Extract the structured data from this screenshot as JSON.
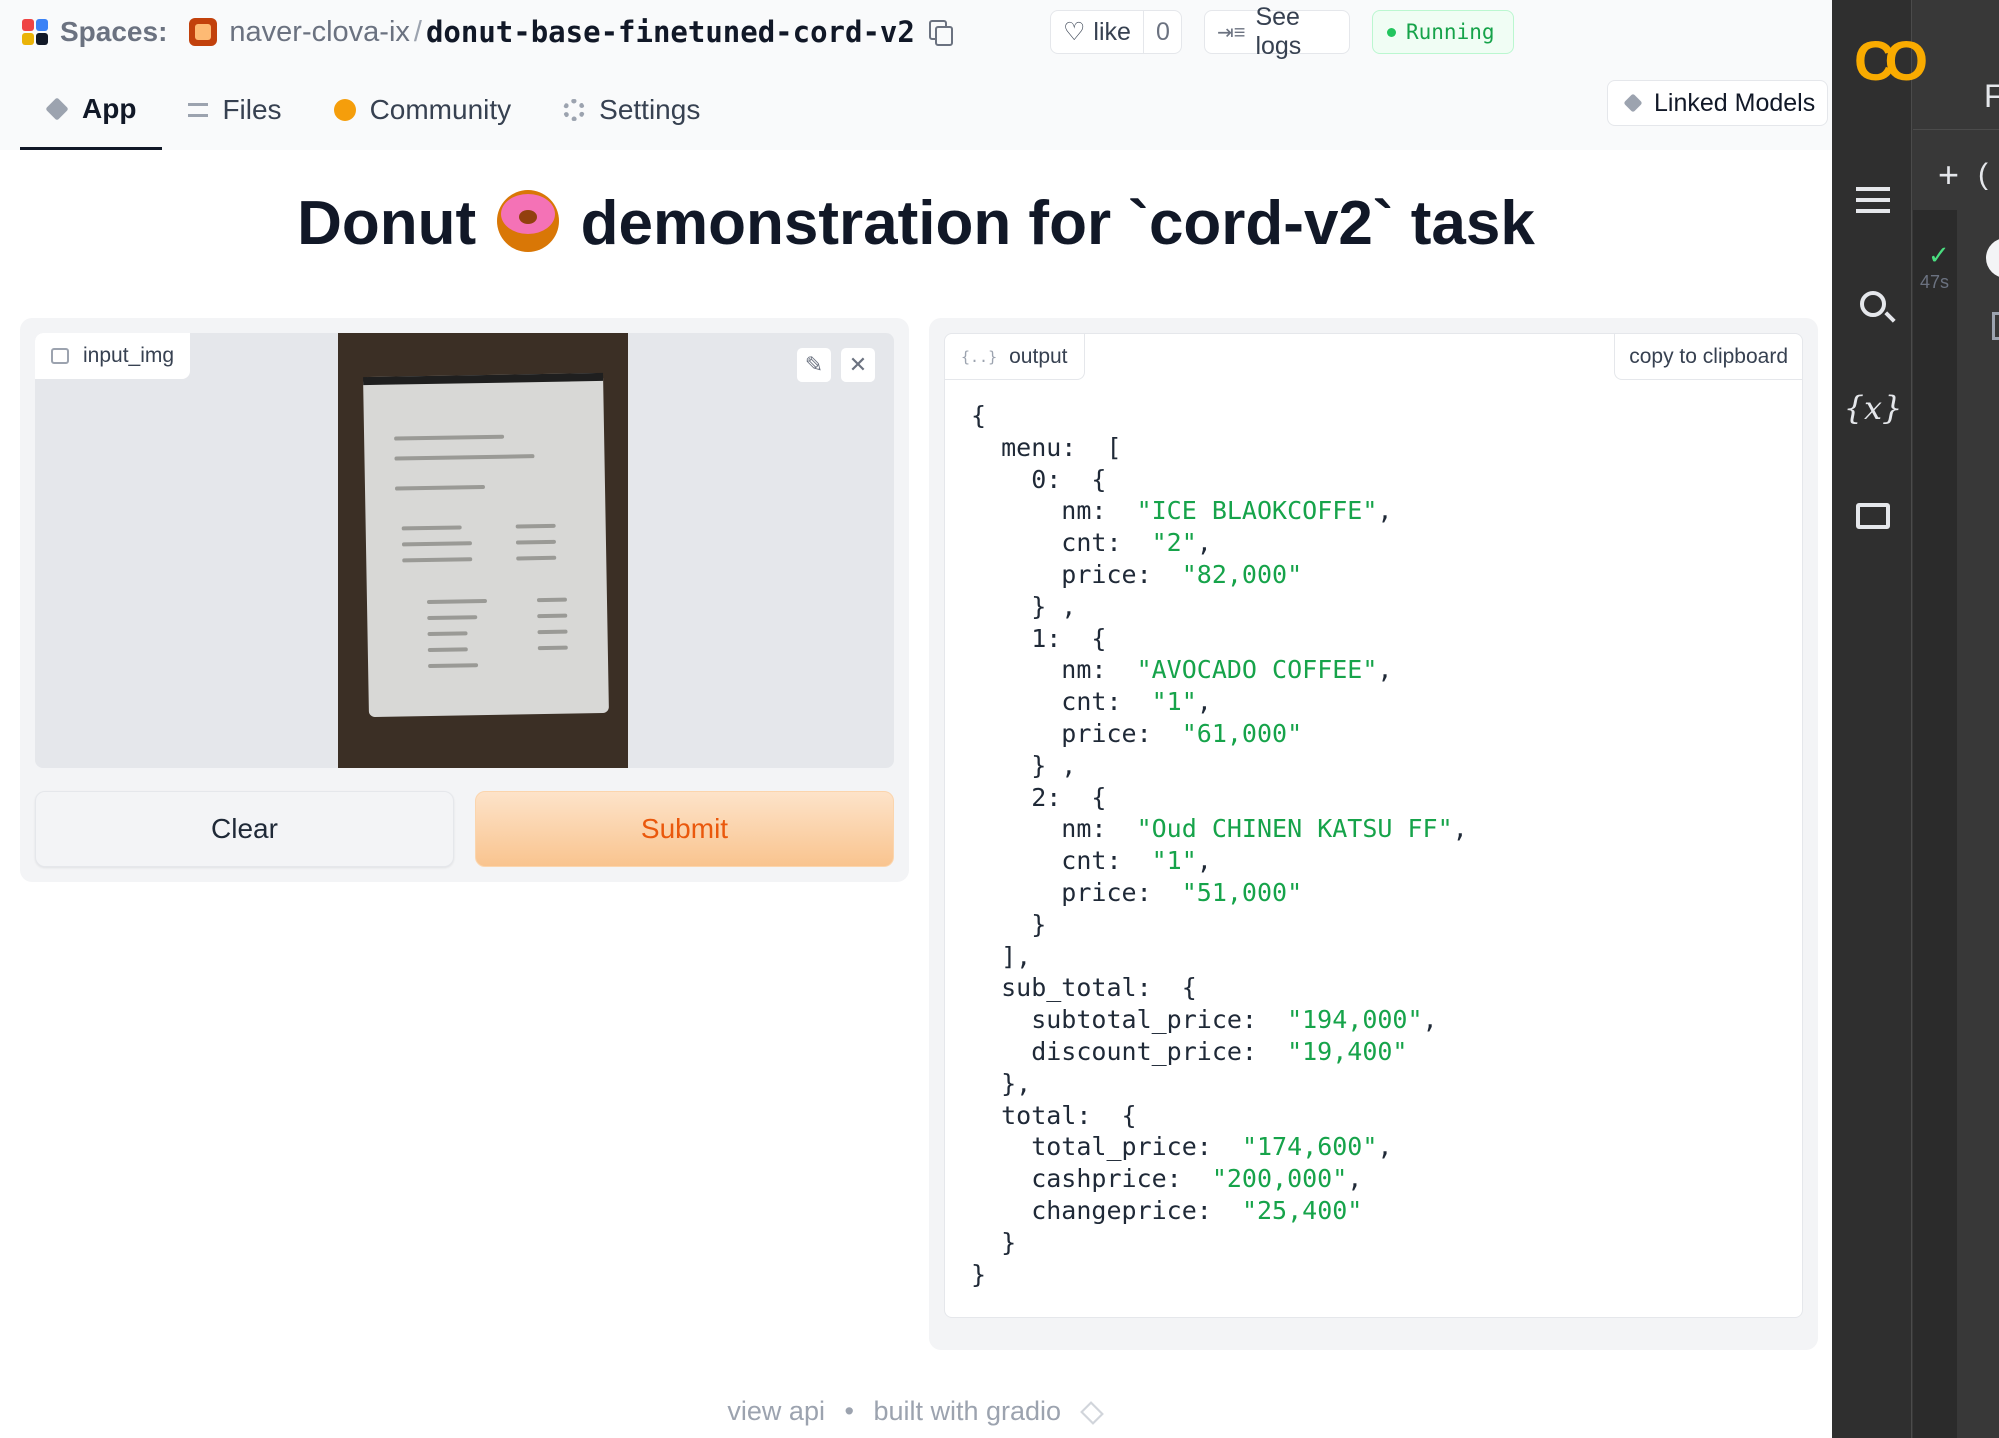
{
  "header": {
    "spaces_label": "Spaces:",
    "org": "naver-clova-ix",
    "separator": "/",
    "repo": "donut-base-finetuned-cord-v2",
    "like_label": "like",
    "like_count": "0",
    "logs_label": "See logs",
    "status": "Running",
    "status_color": "#16a34a"
  },
  "tabs": [
    {
      "label": "App",
      "icon": "cube-icon"
    },
    {
      "label": "Files",
      "icon": "files-icon"
    },
    {
      "label": "Community",
      "icon": "community-icon"
    },
    {
      "label": "Settings",
      "icon": "gear-icon"
    }
  ],
  "linked_models_label": "Linked Models",
  "page": {
    "title_pre": "Donut",
    "title_post": "demonstration for `cord-v2` task"
  },
  "input": {
    "label": "input_img",
    "clear_label": "Clear",
    "submit_label": "Submit"
  },
  "output": {
    "label": "output",
    "copy_label": "copy to clipboard",
    "lines": [
      {
        "text": "{"
      },
      {
        "text": "  menu:  ["
      },
      {
        "text": "    0:  {"
      },
      {
        "text": "      nm:  ",
        "value": "\"ICE BLAOKCOFFE\"",
        "suffix": ","
      },
      {
        "text": "      cnt:  ",
        "value": "\"2\"",
        "suffix": ","
      },
      {
        "text": "      price:  ",
        "value": "\"82,000\""
      },
      {
        "text": "    } ,"
      },
      {
        "text": "    1:  {"
      },
      {
        "text": "      nm:  ",
        "value": "\"AVOCADO COFFEE\"",
        "suffix": ","
      },
      {
        "text": "      cnt:  ",
        "value": "\"1\"",
        "suffix": ","
      },
      {
        "text": "      price:  ",
        "value": "\"61,000\""
      },
      {
        "text": "    } ,"
      },
      {
        "text": "    2:  {"
      },
      {
        "text": "      nm:  ",
        "value": "\"Oud CHINEN KATSU FF\"",
        "suffix": ","
      },
      {
        "text": "      cnt:  ",
        "value": "\"1\"",
        "suffix": ","
      },
      {
        "text": "      price:  ",
        "value": "\"51,000\""
      },
      {
        "text": "    }"
      },
      {
        "text": "  ],"
      },
      {
        "text": "  sub_total:  {"
      },
      {
        "text": "    subtotal_price:  ",
        "value": "\"194,000\"",
        "suffix": ","
      },
      {
        "text": "    discount_price:  ",
        "value": "\"19,400\""
      },
      {
        "text": "  },"
      },
      {
        "text": "  total:  {"
      },
      {
        "text": "    total_price:  ",
        "value": "\"174,600\"",
        "suffix": ","
      },
      {
        "text": "    cashprice:  ",
        "value": "\"200,000\"",
        "suffix": ","
      },
      {
        "text": "    changeprice:  ",
        "value": "\"25,400\""
      },
      {
        "text": "  }"
      },
      {
        "text": "}"
      }
    ]
  },
  "footer": {
    "view_api": "view api",
    "dot": "•",
    "built_with": "built with gradio"
  },
  "colab": {
    "logo": "CO",
    "cut_label": "F",
    "add_label": "+",
    "add_cut": "(",
    "exec_time": "47s"
  }
}
